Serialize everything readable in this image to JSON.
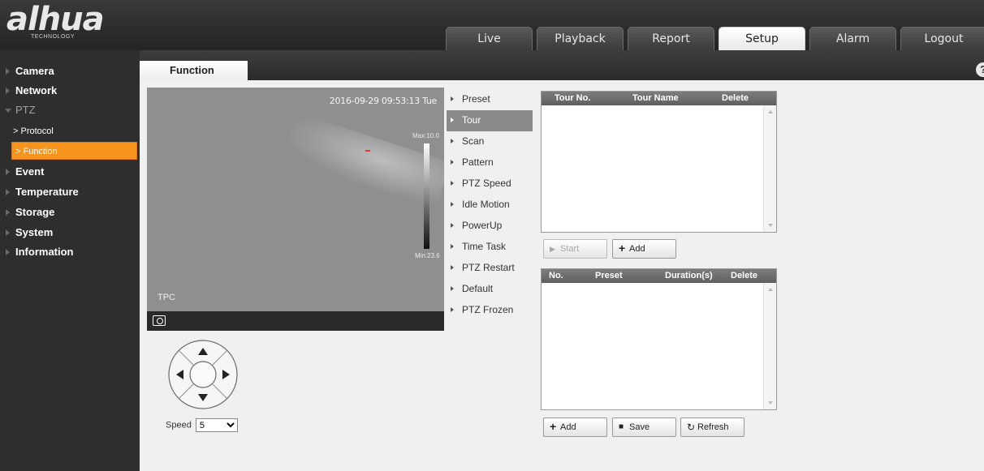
{
  "brand": {
    "name": "alhua",
    "tagline": "TECHNOLOGY"
  },
  "nav": {
    "tabs": [
      {
        "label": "Live",
        "active": false
      },
      {
        "label": "Playback",
        "active": false
      },
      {
        "label": "Report",
        "active": false
      },
      {
        "label": "Setup",
        "active": true
      },
      {
        "label": "Alarm",
        "active": false
      },
      {
        "label": "Logout",
        "active": false
      }
    ]
  },
  "sidebar": {
    "items": [
      {
        "label": "Camera"
      },
      {
        "label": "Network"
      },
      {
        "label": "PTZ",
        "expanded": true
      },
      {
        "label": "Event"
      },
      {
        "label": "Temperature"
      },
      {
        "label": "Storage"
      },
      {
        "label": "System"
      },
      {
        "label": "Information"
      }
    ],
    "ptz_children": [
      {
        "label": "> Protocol",
        "active": false
      },
      {
        "label": "> Function",
        "active": true
      }
    ]
  },
  "page": {
    "tab": "Function",
    "help_icon": "?"
  },
  "video": {
    "timestamp": "2016-09-29 09:53:13 Tue",
    "max_label": "Max:10.0",
    "min_label": "Min:23.6",
    "channel": "TPC",
    "snapshot_icon": "camera-icon"
  },
  "ptz_control": {
    "speed_label": "Speed",
    "speed_value": "5"
  },
  "function_menu": {
    "items": [
      {
        "label": "Preset",
        "active": false
      },
      {
        "label": "Tour",
        "active": true
      },
      {
        "label": "Scan",
        "active": false
      },
      {
        "label": "Pattern",
        "active": false
      },
      {
        "label": "PTZ Speed",
        "active": false
      },
      {
        "label": "Idle Motion",
        "active": false
      },
      {
        "label": "PowerUp",
        "active": false
      },
      {
        "label": "Time Task",
        "active": false
      },
      {
        "label": "PTZ Restart",
        "active": false
      },
      {
        "label": "Default",
        "active": false
      },
      {
        "label": "PTZ Frozen",
        "active": false
      }
    ]
  },
  "tour_table": {
    "headers": {
      "no": "Tour No.",
      "name": "Tour Name",
      "delete": "Delete"
    },
    "rows": []
  },
  "tour_buttons": {
    "start": "Start",
    "add": "Add"
  },
  "preset_table": {
    "headers": {
      "no": "No.",
      "preset": "Preset",
      "duration": "Duration(s)",
      "delete": "Delete"
    },
    "rows": []
  },
  "preset_buttons": {
    "add": "Add",
    "save": "Save",
    "refresh": "Refresh"
  }
}
